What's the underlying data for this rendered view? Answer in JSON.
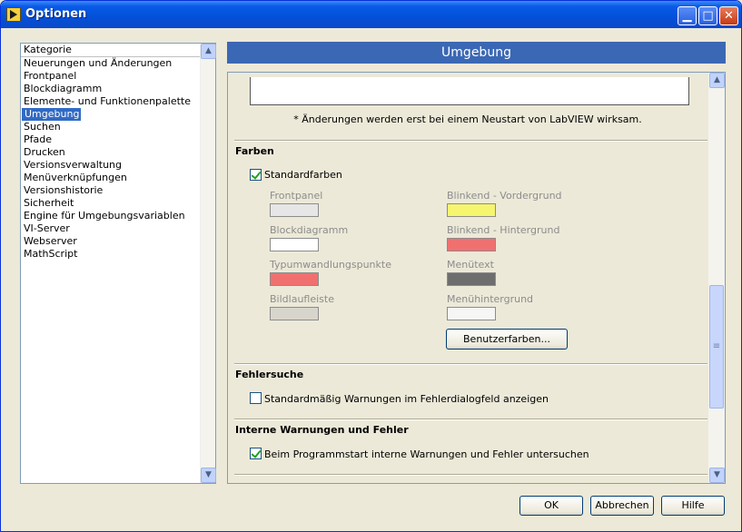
{
  "window": {
    "title": "Optionen"
  },
  "sidebar": {
    "header": "Kategorie",
    "items": [
      "Neuerungen und Änderungen",
      "Frontpanel",
      "Blockdiagramm",
      "Elemente- und Funktionenpalette",
      "Umgebung",
      "Suchen",
      "Pfade",
      "Drucken",
      "Versionsverwaltung",
      "Menüverknüpfungen",
      "Versionshistorie",
      "Sicherheit",
      "Engine für Umgebungsvariablen",
      "VI-Server",
      "Webserver",
      "MathScript"
    ],
    "selected": "Umgebung"
  },
  "page": {
    "title": "Umgebung",
    "restart_note": "* Änderungen werden erst bei einem Neustart von LabVIEW wirksam.",
    "colors": {
      "title": "Farben",
      "default_colors_label": "Standardfarben",
      "default_colors_checked": true,
      "frontpanel": "Frontpanel",
      "blockdiagram": "Blockdiagramm",
      "coercion_dots": "Typumwandlungspunkte",
      "scrollbar": "Bildlaufleiste",
      "blink_fg": "Blinkend - Vordergrund",
      "blink_bg": "Blinkend - Hintergrund",
      "menu_text": "Menütext",
      "menu_bg": "Menühintergrund",
      "user_colors_button": "Benutzerfarben...",
      "swatches": {
        "frontpanel": "#e6e6e6",
        "blockdiagram": "#ffffff",
        "coercion_dots": "#f07070",
        "scrollbar": "#d8d5cc",
        "blink_fg": "#f5f56e",
        "blink_bg": "#f07070",
        "menu_text": "#6e6e6e",
        "menu_bg": "#f6f6f6"
      }
    },
    "debugging": {
      "title": "Fehlersuche",
      "warnings_label": "Standardmäßig Warnungen im Fehlerdialogfeld anzeigen",
      "warnings_checked": false
    },
    "internal": {
      "title": "Interne Warnungen und Fehler",
      "check_label": "Beim Programmstart interne Warnungen und Fehler untersuchen",
      "check_checked": true
    }
  },
  "buttons": {
    "ok": "OK",
    "cancel": "Abbrechen",
    "help": "Hilfe"
  }
}
